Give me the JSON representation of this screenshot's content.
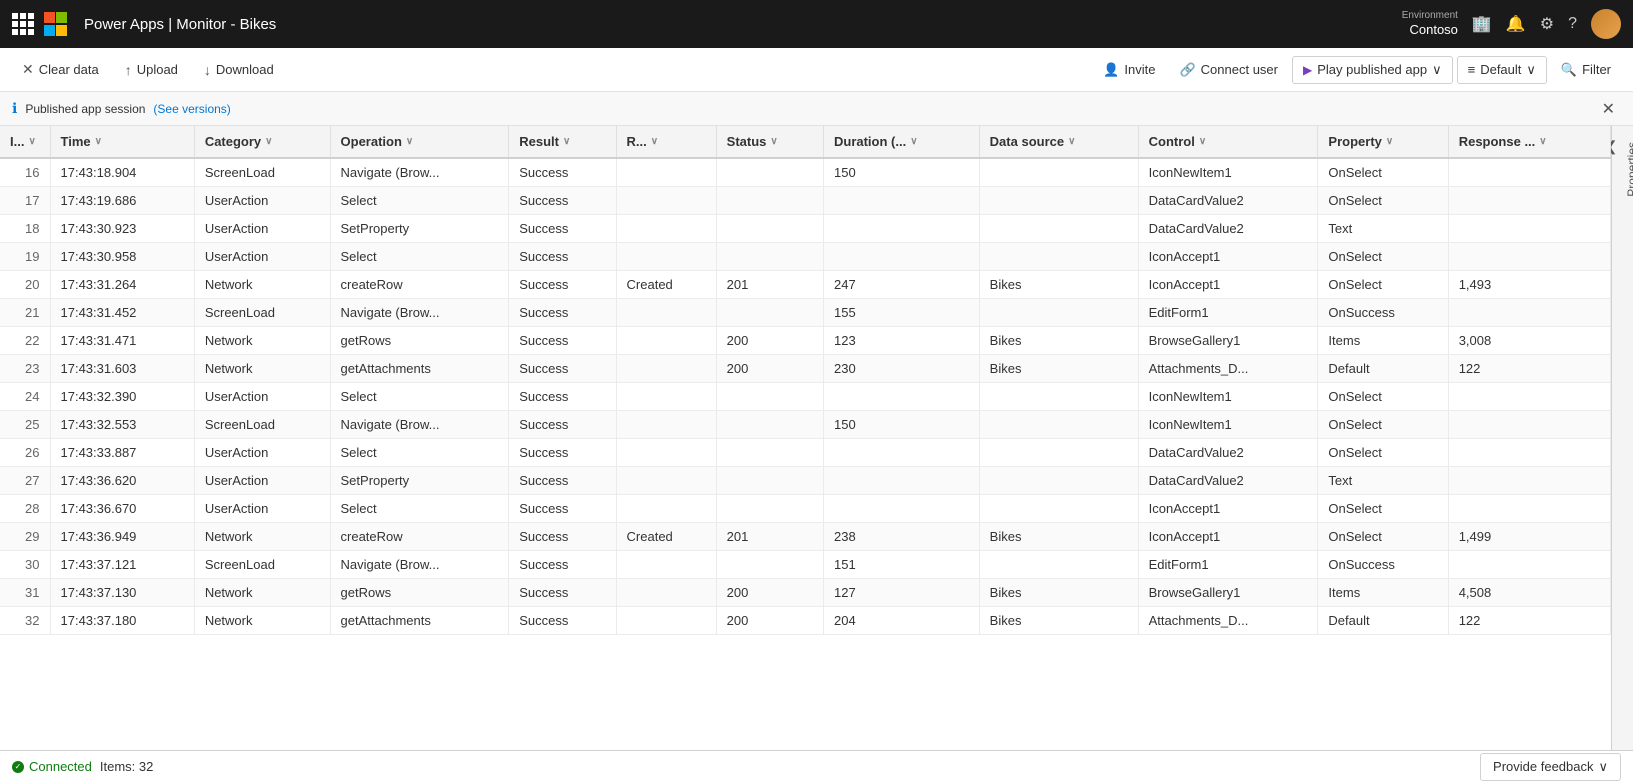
{
  "topnav": {
    "app_title": "Power Apps | Monitor - Bikes",
    "env_label": "Environment",
    "env_name": "Contoso"
  },
  "toolbar": {
    "clear_data_label": "Clear data",
    "upload_label": "Upload",
    "download_label": "Download",
    "invite_label": "Invite",
    "connect_user_label": "Connect user",
    "play_published_app_label": "Play published app",
    "default_label": "Default",
    "filter_label": "Filter"
  },
  "info_bar": {
    "text": "Published app session",
    "link_text": "(See versions)"
  },
  "columns": [
    {
      "id": "id",
      "label": "I..."
    },
    {
      "id": "time",
      "label": "Time"
    },
    {
      "id": "category",
      "label": "Category"
    },
    {
      "id": "operation",
      "label": "Operation"
    },
    {
      "id": "result",
      "label": "Result"
    },
    {
      "id": "r",
      "label": "R..."
    },
    {
      "id": "status",
      "label": "Status"
    },
    {
      "id": "duration",
      "label": "Duration (..."
    },
    {
      "id": "datasource",
      "label": "Data source"
    },
    {
      "id": "control",
      "label": "Control"
    },
    {
      "id": "property",
      "label": "Property"
    },
    {
      "id": "response",
      "label": "Response ..."
    }
  ],
  "rows": [
    {
      "id": 16,
      "time": "17:43:18.904",
      "category": "ScreenLoad",
      "operation": "Navigate (Brow...",
      "result": "Success",
      "r": "",
      "status": "",
      "duration": "150",
      "datasource": "",
      "control": "IconNewItem1",
      "property": "OnSelect",
      "response": ""
    },
    {
      "id": 17,
      "time": "17:43:19.686",
      "category": "UserAction",
      "operation": "Select",
      "result": "Success",
      "r": "",
      "status": "",
      "duration": "",
      "datasource": "",
      "control": "DataCardValue2",
      "property": "OnSelect",
      "response": ""
    },
    {
      "id": 18,
      "time": "17:43:30.923",
      "category": "UserAction",
      "operation": "SetProperty",
      "result": "Success",
      "r": "",
      "status": "",
      "duration": "",
      "datasource": "",
      "control": "DataCardValue2",
      "property": "Text",
      "response": ""
    },
    {
      "id": 19,
      "time": "17:43:30.958",
      "category": "UserAction",
      "operation": "Select",
      "result": "Success",
      "r": "",
      "status": "",
      "duration": "",
      "datasource": "",
      "control": "IconAccept1",
      "property": "OnSelect",
      "response": ""
    },
    {
      "id": 20,
      "time": "17:43:31.264",
      "category": "Network",
      "operation": "createRow",
      "result": "Success",
      "r": "Created",
      "status": "201",
      "duration": "247",
      "datasource": "Bikes",
      "control": "IconAccept1",
      "property": "OnSelect",
      "response": "1,493"
    },
    {
      "id": 21,
      "time": "17:43:31.452",
      "category": "ScreenLoad",
      "operation": "Navigate (Brow...",
      "result": "Success",
      "r": "",
      "status": "",
      "duration": "155",
      "datasource": "",
      "control": "EditForm1",
      "property": "OnSuccess",
      "response": ""
    },
    {
      "id": 22,
      "time": "17:43:31.471",
      "category": "Network",
      "operation": "getRows",
      "result": "Success",
      "r": "",
      "status": "200",
      "duration": "123",
      "datasource": "Bikes",
      "control": "BrowseGallery1",
      "property": "Items",
      "response": "3,008"
    },
    {
      "id": 23,
      "time": "17:43:31.603",
      "category": "Network",
      "operation": "getAttachments",
      "result": "Success",
      "r": "",
      "status": "200",
      "duration": "230",
      "datasource": "Bikes",
      "control": "Attachments_D...",
      "property": "Default",
      "response": "122"
    },
    {
      "id": 24,
      "time": "17:43:32.390",
      "category": "UserAction",
      "operation": "Select",
      "result": "Success",
      "r": "",
      "status": "",
      "duration": "",
      "datasource": "",
      "control": "IconNewItem1",
      "property": "OnSelect",
      "response": ""
    },
    {
      "id": 25,
      "time": "17:43:32.553",
      "category": "ScreenLoad",
      "operation": "Navigate (Brow...",
      "result": "Success",
      "r": "",
      "status": "",
      "duration": "150",
      "datasource": "",
      "control": "IconNewItem1",
      "property": "OnSelect",
      "response": ""
    },
    {
      "id": 26,
      "time": "17:43:33.887",
      "category": "UserAction",
      "operation": "Select",
      "result": "Success",
      "r": "",
      "status": "",
      "duration": "",
      "datasource": "",
      "control": "DataCardValue2",
      "property": "OnSelect",
      "response": ""
    },
    {
      "id": 27,
      "time": "17:43:36.620",
      "category": "UserAction",
      "operation": "SetProperty",
      "result": "Success",
      "r": "",
      "status": "",
      "duration": "",
      "datasource": "",
      "control": "DataCardValue2",
      "property": "Text",
      "response": ""
    },
    {
      "id": 28,
      "time": "17:43:36.670",
      "category": "UserAction",
      "operation": "Select",
      "result": "Success",
      "r": "",
      "status": "",
      "duration": "",
      "datasource": "",
      "control": "IconAccept1",
      "property": "OnSelect",
      "response": ""
    },
    {
      "id": 29,
      "time": "17:43:36.949",
      "category": "Network",
      "operation": "createRow",
      "result": "Success",
      "r": "Created",
      "status": "201",
      "duration": "238",
      "datasource": "Bikes",
      "control": "IconAccept1",
      "property": "OnSelect",
      "response": "1,499"
    },
    {
      "id": 30,
      "time": "17:43:37.121",
      "category": "ScreenLoad",
      "operation": "Navigate (Brow...",
      "result": "Success",
      "r": "",
      "status": "",
      "duration": "151",
      "datasource": "",
      "control": "EditForm1",
      "property": "OnSuccess",
      "response": ""
    },
    {
      "id": 31,
      "time": "17:43:37.130",
      "category": "Network",
      "operation": "getRows",
      "result": "Success",
      "r": "",
      "status": "200",
      "duration": "127",
      "datasource": "Bikes",
      "control": "BrowseGallery1",
      "property": "Items",
      "response": "4,508"
    },
    {
      "id": 32,
      "time": "17:43:37.180",
      "category": "Network",
      "operation": "getAttachments",
      "result": "Success",
      "r": "",
      "status": "200",
      "duration": "204",
      "datasource": "Bikes",
      "control": "Attachments_D...",
      "property": "Default",
      "response": "122"
    }
  ],
  "status_bar": {
    "connected_label": "Connected",
    "items_label": "Items: 32",
    "feedback_label": "Provide feedback"
  },
  "side_panel": {
    "label": "Properties"
  }
}
